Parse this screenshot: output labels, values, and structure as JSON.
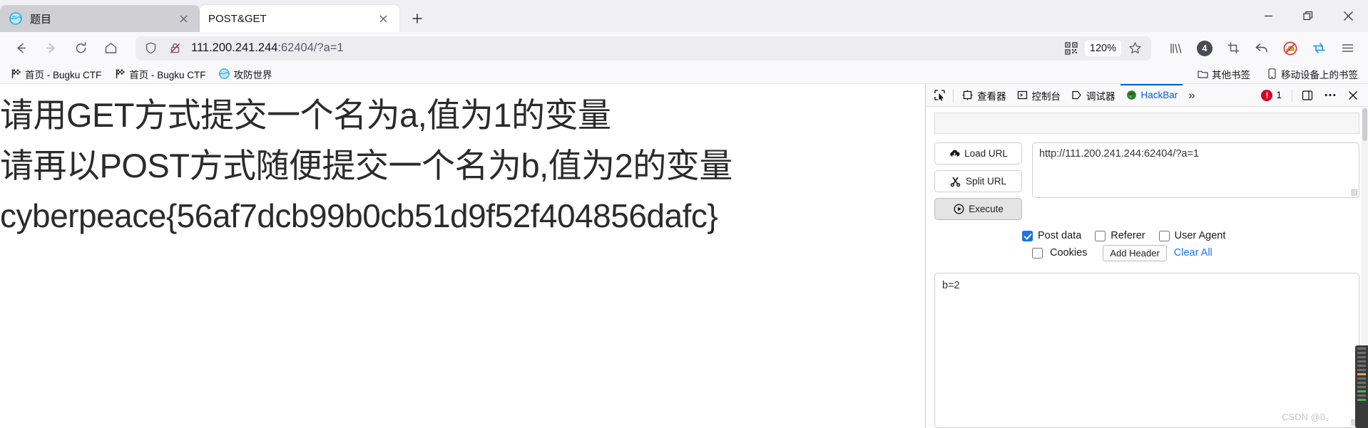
{
  "window": {
    "controls": {
      "minimize": "minimize-button",
      "maximize": "maximize-button",
      "close": "close-button"
    }
  },
  "tabs": [
    {
      "title": "题目",
      "favicon": "globe-blue-icon",
      "active": false,
      "close_label": "✕"
    },
    {
      "title": "POST&GET",
      "favicon": "none",
      "active": true,
      "close_label": "✕"
    }
  ],
  "newtab_label": "+",
  "navbar": {
    "back_icon": "back-arrow-icon",
    "forward_icon": "forward-arrow-icon",
    "reload_icon": "reload-icon",
    "home_icon": "home-icon",
    "url_host": "111.200.241.244",
    "url_rest": ":62404/?a=1",
    "zoom_level": "120%",
    "qr_icon": "qr-code-icon",
    "star_icon": "bookmark-star-icon",
    "shield_icon": "shield-icon",
    "lock_icon": "lock-crossed-icon",
    "tools": {
      "library_icon": "library-icon",
      "container_count": "4",
      "screenshot_icon": "crop-screenshot-icon",
      "undo_icon": "undo-arrow-icon",
      "adblock_icon": "adblock-disabled-icon",
      "sync_icon": "sync-tabs-icon",
      "menu_icon": "hamburger-menu-icon"
    }
  },
  "bookmarks": {
    "items": [
      {
        "label": "首页 - Bugku CTF",
        "icon": "checkered-flag-icon"
      },
      {
        "label": "首页 - Bugku CTF",
        "icon": "checkered-flag-icon"
      },
      {
        "label": "攻防世界",
        "icon": "globe-blue-icon"
      }
    ],
    "right_items": [
      {
        "label": "其他书签",
        "icon": "folder-icon"
      },
      {
        "label": "移动设备上的书签",
        "icon": "mobile-device-icon"
      }
    ]
  },
  "page": {
    "lines": [
      "请用GET方式提交一个名为a,值为1的变量",
      "请再以POST方式随便提交一个名为b,值为2的变量",
      "cyberpeace{56af7dcb99b0cb51d9f52f404856dafc}"
    ]
  },
  "devtools": {
    "picker_icon": "element-picker-icon",
    "tabs": [
      {
        "label": "查看器",
        "icon": "inspector-icon",
        "active": false
      },
      {
        "label": "控制台",
        "icon": "console-icon",
        "active": false
      },
      {
        "label": "调试器",
        "icon": "debugger-icon",
        "active": false
      },
      {
        "label": "HackBar",
        "icon": "hackbar-icon",
        "active": true
      }
    ],
    "overflow_label": "»",
    "error_count": "1",
    "error_mark": "!",
    "dock_icon": "dock-layout-icon",
    "more_icon": "more-options-icon",
    "close_icon": "close-devtools-icon"
  },
  "hackbar": {
    "buttons": [
      {
        "label": "Load URL",
        "icon": "cloud-download-icon",
        "pressed": false
      },
      {
        "label": "Split URL",
        "icon": "scissors-icon",
        "pressed": false
      },
      {
        "label": "Execute",
        "icon": "play-circle-icon",
        "pressed": true
      }
    ],
    "url_value": "http://111.200.241.244:62404/?a=1",
    "options_row1": [
      {
        "label": "Post data",
        "checked": true
      },
      {
        "label": "Referer",
        "checked": false
      },
      {
        "label": "User Agent",
        "checked": false
      }
    ],
    "options_row2": [
      {
        "label": "Cookies",
        "checked": false
      }
    ],
    "add_header_label": "Add Header",
    "clear_all_label": "Clear All",
    "post_data_value": "b=2",
    "watermark": "CSDN @0。"
  },
  "colors": {
    "accent_blue": "#0060df",
    "link_blue": "#1a73e8",
    "checkbox_blue": "#1a73e8",
    "error_red": "#d70022",
    "tab_inactive": "#cfcfd4",
    "toolbar_bg": "#f9f9fb"
  }
}
